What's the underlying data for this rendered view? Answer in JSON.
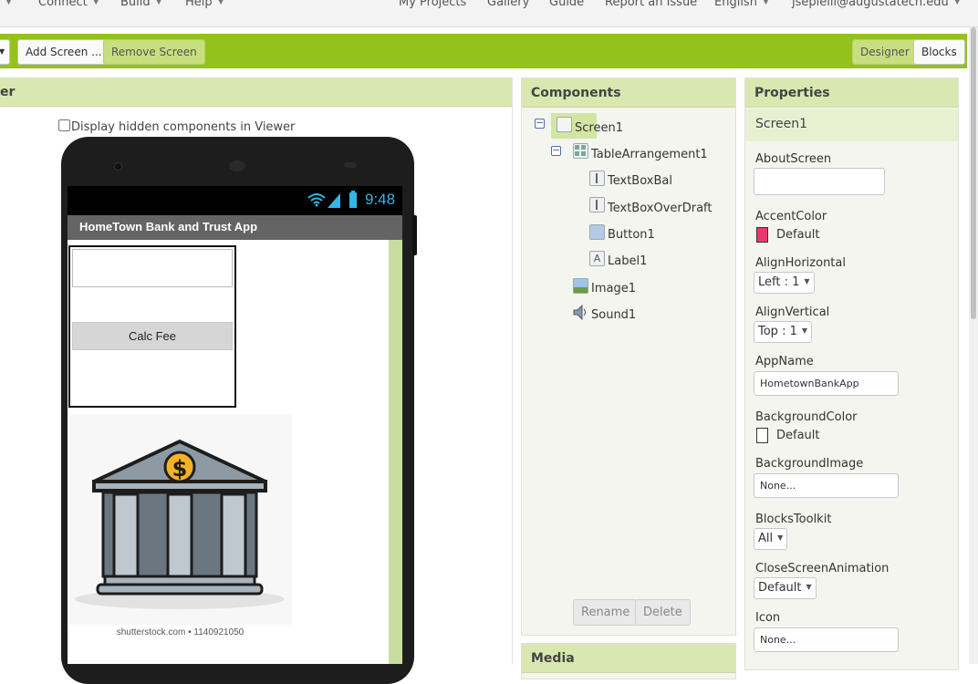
{
  "topnav": {
    "connect": "Connect",
    "build": "Build",
    "help": "Help",
    "my_projects": "My Projects",
    "gallery": "Gallery",
    "guide": "Guide",
    "report_issue": "Report an Issue",
    "language": "English",
    "user": "jsepielli@augustatech.edu"
  },
  "toolbar": {
    "add_screen": "Add Screen ...",
    "remove_screen": "Remove Screen",
    "designer": "Designer",
    "blocks": "Blocks"
  },
  "viewer": {
    "title": "er",
    "hidden_components_label": "Display hidden components in Viewer",
    "phone": {
      "time": "9:48",
      "app_title": "HomeTown Bank and Trust App",
      "button_label": "Calc Fee",
      "image_caption": "shutterstock.com • 1140921050"
    }
  },
  "components": {
    "title": "Components",
    "tree": [
      {
        "label": "Screen1",
        "icon": "screen-icon",
        "selected": true
      },
      {
        "label": "TableArrangement1",
        "icon": "table-arrangement-icon"
      },
      {
        "label": "TextBoxBal",
        "icon": "textbox-icon"
      },
      {
        "label": "TextBoxOverDraft",
        "icon": "textbox-icon"
      },
      {
        "label": "Button1",
        "icon": "button-icon"
      },
      {
        "label": "Label1",
        "icon": "label-icon"
      },
      {
        "label": "Image1",
        "icon": "image-icon"
      },
      {
        "label": "Sound1",
        "icon": "sound-icon"
      }
    ],
    "rename": "Rename",
    "delete": "Delete"
  },
  "media": {
    "title": "Media"
  },
  "properties": {
    "title": "Properties",
    "selected": "Screen1",
    "about_screen": {
      "label": "AboutScreen",
      "value": ""
    },
    "accent_color": {
      "label": "AccentColor",
      "value": "Default",
      "color": "#e8386c"
    },
    "align_horizontal": {
      "label": "AlignHorizontal",
      "value": "Left : 1"
    },
    "align_vertical": {
      "label": "AlignVertical",
      "value": "Top : 1"
    },
    "app_name": {
      "label": "AppName",
      "value": "HometownBankApp"
    },
    "background_color": {
      "label": "BackgroundColor",
      "value": "Default",
      "color": "#ffffff"
    },
    "background_image": {
      "label": "BackgroundImage",
      "value": "None..."
    },
    "blocks_toolkit": {
      "label": "BlocksToolkit",
      "value": "All"
    },
    "close_screen_animation": {
      "label": "CloseScreenAnimation",
      "value": "Default"
    },
    "icon": {
      "label": "Icon",
      "value": "None..."
    }
  },
  "colors": {
    "toolbar_green": "#95c11f",
    "panel_header": "#d8e8b0",
    "accent_pink": "#e8386c"
  }
}
